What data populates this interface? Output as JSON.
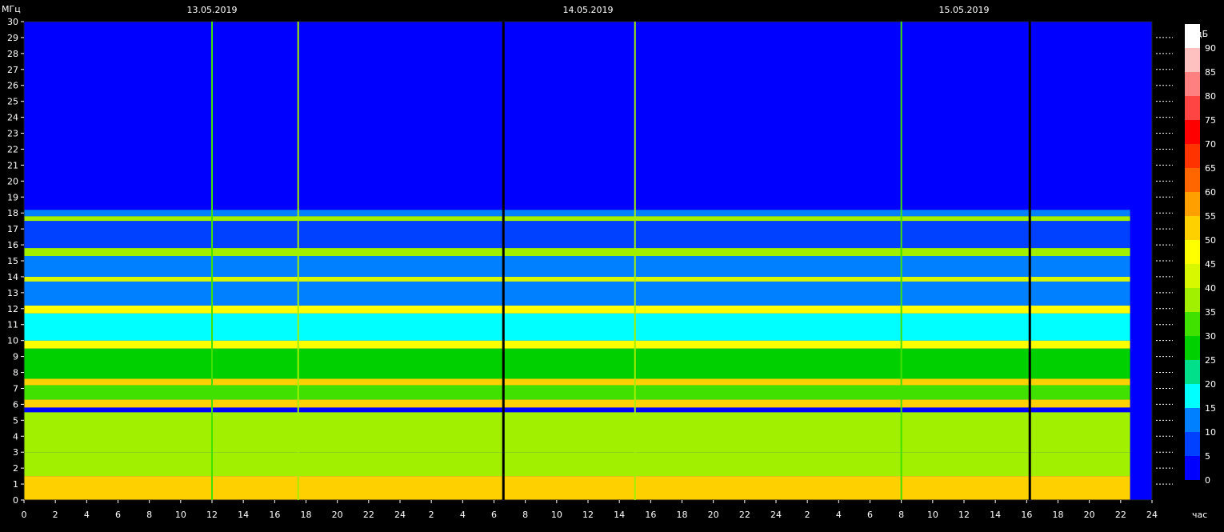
{
  "chart_data": {
    "type": "heatmap",
    "ylabel": "МГц",
    "xlabel": "час",
    "ylim": [
      0,
      30
    ],
    "yticks": [
      0,
      1,
      2,
      3,
      4,
      5,
      6,
      7,
      8,
      9,
      10,
      11,
      12,
      13,
      14,
      15,
      16,
      17,
      18,
      19,
      20,
      21,
      22,
      23,
      24,
      25,
      26,
      27,
      28,
      29,
      30
    ],
    "xticks": [
      "0",
      "2",
      "4",
      "6",
      "8",
      "10",
      "12",
      "14",
      "16",
      "18",
      "20",
      "22",
      "24",
      "2",
      "4",
      "6",
      "8",
      "10",
      "12",
      "14",
      "16",
      "18",
      "20",
      "22",
      "24",
      "2",
      "4",
      "6",
      "8",
      "10",
      "12",
      "14",
      "16",
      "18",
      "20",
      "22",
      "24"
    ],
    "date_labels": [
      "13.05.2019",
      "14.05.2019",
      "15.05.2019"
    ],
    "colorbar": {
      "label": "дБ",
      "ticks": [
        0,
        5,
        10,
        15,
        20,
        25,
        30,
        35,
        40,
        45,
        50,
        55,
        60,
        65,
        70,
        75,
        80,
        85,
        90
      ],
      "colors": [
        "#0000ff",
        "#0040ff",
        "#0080ff",
        "#00ffff",
        "#00e08a",
        "#00d000",
        "#40e000",
        "#a0f000",
        "#d8f800",
        "#ffff00",
        "#ffd000",
        "#ffa000",
        "#ff6600",
        "#ff3300",
        "#ff0000",
        "#ff4444",
        "#ff8080",
        "#ffc0c0",
        "#ffffff"
      ]
    },
    "time_span_hours": [
      0,
      72
    ],
    "time_ticks": [
      0,
      2,
      4,
      6,
      8,
      10,
      12,
      14,
      16,
      18,
      20,
      22,
      24,
      26,
      28,
      30,
      32,
      34,
      36,
      38,
      40,
      42,
      44,
      46,
      48,
      50,
      52,
      54,
      56,
      58,
      60,
      62,
      64,
      66,
      68,
      70,
      72
    ],
    "data_end_hour": 70.6,
    "bands": [
      {
        "freq": [
          0.0,
          1.5
        ],
        "level": 48
      },
      {
        "freq": [
          1.5,
          3.0
        ],
        "level": 36
      },
      {
        "freq": [
          3.0,
          5.5
        ],
        "level": 33
      },
      {
        "freq": [
          5.8,
          6.3
        ],
        "level": 52
      },
      {
        "freq": [
          6.3,
          7.2
        ],
        "level": 32
      },
      {
        "freq": [
          7.2,
          7.6
        ],
        "level": 50
      },
      {
        "freq": [
          7.6,
          9.5
        ],
        "level": 24
      },
      {
        "freq": [
          9.5,
          10.0
        ],
        "level": 47
      },
      {
        "freq": [
          10.0,
          11.7
        ],
        "level": 16
      },
      {
        "freq": [
          11.7,
          12.2
        ],
        "level": 43
      },
      {
        "freq": [
          12.2,
          13.7
        ],
        "level": 12
      },
      {
        "freq": [
          13.7,
          14.0
        ],
        "level": 38
      },
      {
        "freq": [
          14.0,
          15.3
        ],
        "level": 12
      },
      {
        "freq": [
          15.3,
          15.8
        ],
        "level": 33
      },
      {
        "freq": [
          15.8,
          17.5
        ],
        "level": 7
      },
      {
        "freq": [
          17.5,
          17.8
        ],
        "level": 35
      },
      {
        "freq": [
          17.8,
          18.2
        ],
        "level": 10
      },
      {
        "freq": [
          18.2,
          30.0
        ],
        "level": 2
      }
    ],
    "vertical_lines": [
      {
        "hour": 12.0,
        "level": 28
      },
      {
        "hour": 17.5,
        "level": 35
      },
      {
        "hour": 30.6,
        "level": 0
      },
      {
        "hour": 39.0,
        "level": 35
      },
      {
        "hour": 56.0,
        "level": 32
      },
      {
        "hour": 64.2,
        "level": 0
      }
    ]
  }
}
